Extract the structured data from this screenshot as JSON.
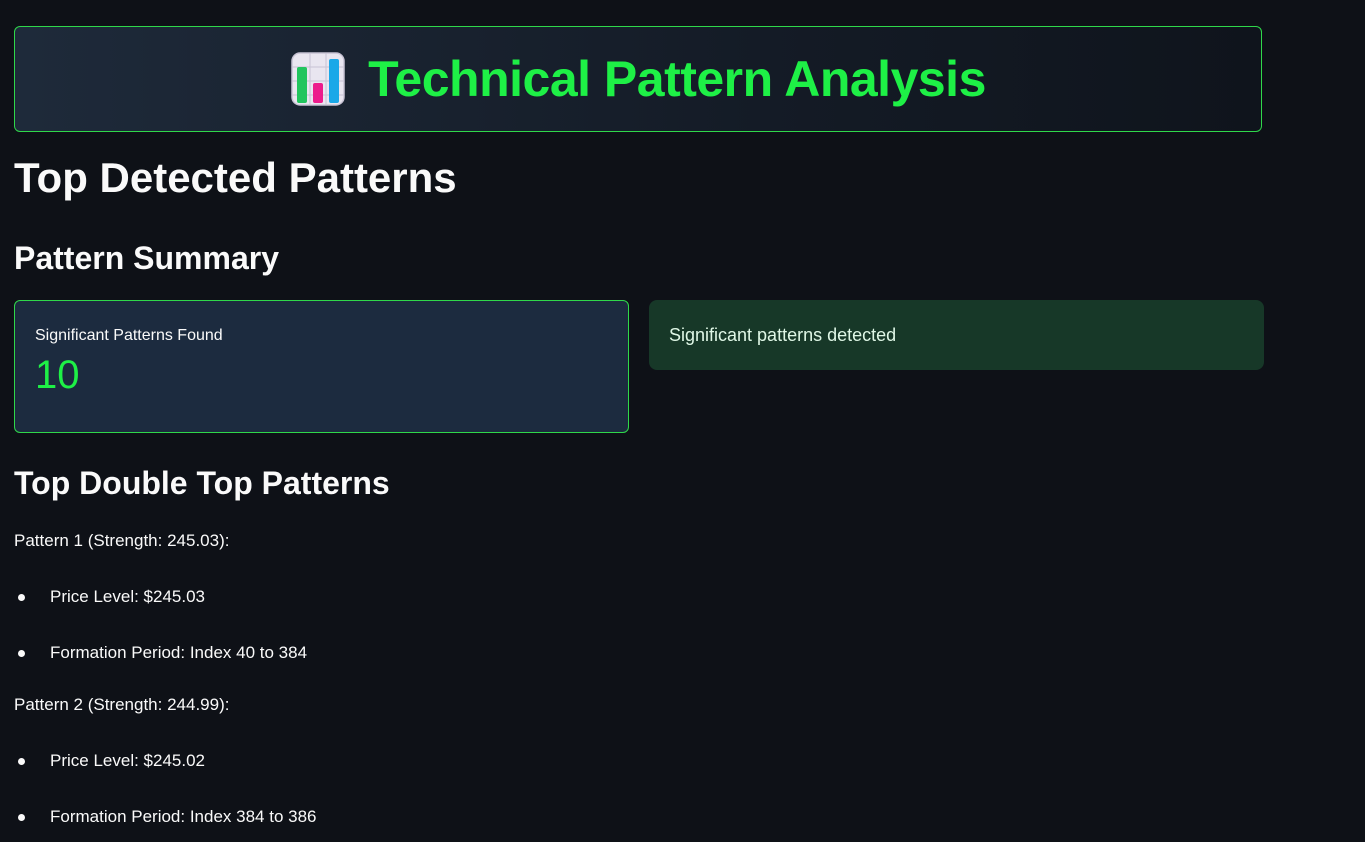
{
  "header": {
    "icon": "bar-chart-icon",
    "title": "Technical Pattern Analysis",
    "accent_color": "#1ef046"
  },
  "main": {
    "page_heading": "Top Detected Patterns",
    "summary_heading": "Pattern Summary",
    "metric": {
      "label": "Significant Patterns Found",
      "value": "10"
    },
    "status_message": "Significant patterns detected",
    "section_heading": "Top Double Top Patterns",
    "patterns": [
      {
        "title": "Pattern 1 (Strength: 245.03):",
        "price_level": "Price Level: $245.03",
        "formation_period": "Formation Period: Index 40 to 384"
      },
      {
        "title": "Pattern 2 (Strength: 244.99):",
        "price_level": "Price Level: $245.02",
        "formation_period": "Formation Period: Index 384 to 386"
      }
    ]
  }
}
